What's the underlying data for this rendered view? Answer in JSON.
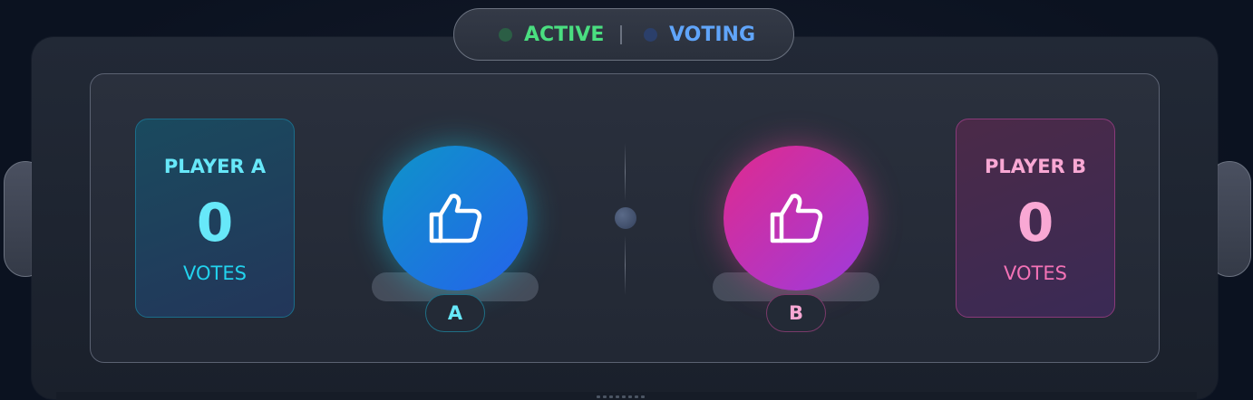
{
  "status": {
    "active_label": "ACTIVE",
    "voting_label": "VOTING",
    "active_color": "#4ade80",
    "voting_color": "#60a5fa"
  },
  "players": {
    "a": {
      "name": "PLAYER A",
      "votes": "0",
      "votes_unit": "VOTES",
      "button_label": "A",
      "button_icon": "thumbs-up-icon",
      "accent": "#22d3ee"
    },
    "b": {
      "name": "PLAYER B",
      "votes": "0",
      "votes_unit": "VOTES",
      "button_label": "B",
      "button_icon": "thumbs-up-icon",
      "accent": "#ec4899"
    }
  }
}
